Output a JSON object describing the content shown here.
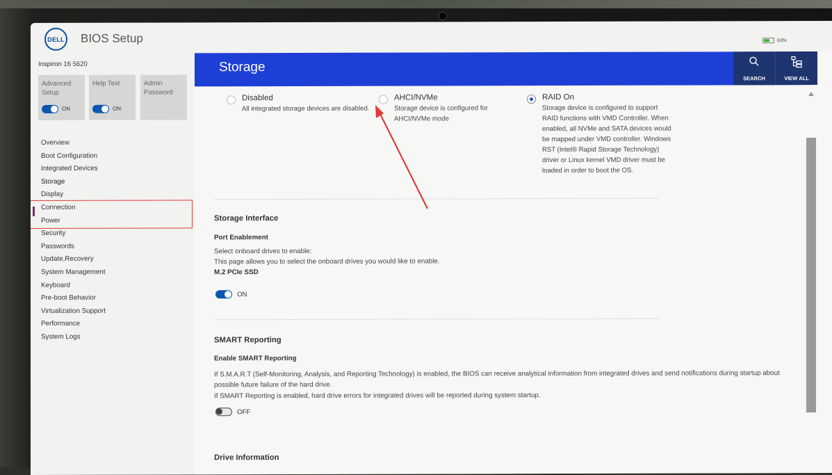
{
  "window": {
    "app_title": "BIOS Setup",
    "logo_text": "DELL",
    "battery_level": "63%"
  },
  "sidebar": {
    "model": "Inspiron 16 5620",
    "tiles": [
      {
        "label": "Advanced Setup",
        "toggle_state": "ON"
      },
      {
        "label": "Help Text",
        "toggle_state": "ON"
      },
      {
        "label": "Admin Password"
      }
    ],
    "items": [
      {
        "label": "Overview"
      },
      {
        "label": "Boot Configuration"
      },
      {
        "label": "Integrated Devices"
      },
      {
        "label": "Storage"
      },
      {
        "label": "Display"
      },
      {
        "label": "Connection"
      },
      {
        "label": "Power"
      },
      {
        "label": "Security"
      },
      {
        "label": "Passwords"
      },
      {
        "label": "Update,Recovery"
      },
      {
        "label": "System Management"
      },
      {
        "label": "Keyboard"
      },
      {
        "label": "Pre-boot Behavior"
      },
      {
        "label": "Virtualization Support"
      },
      {
        "label": "Performance"
      },
      {
        "label": "System Logs"
      }
    ],
    "active_item": "Storage"
  },
  "header": {
    "title": "Storage",
    "search_label": "SEARCH",
    "view_all_label": "VIEW ALL"
  },
  "sata_operation": {
    "options": [
      {
        "label": "Disabled",
        "description": "All integrated storage devices are disabled.",
        "selected": false
      },
      {
        "label": "AHCI/NVMe",
        "description": "Storage device is configured for AHCI/NVMe mode",
        "selected": false
      },
      {
        "label": "RAID On",
        "description": "Storage device is configured to support RAID functions with VMD Controller. When enabled, all NVMe and SATA devices would be mapped under VMD controller. Windows RST (Intel® Rapid Storage Technology) driver or Linux kernel VMD driver must be loaded in order to boot the OS.",
        "selected": true
      }
    ]
  },
  "storage_interface": {
    "title": "Storage Interface",
    "subtitle": "Port Enablement",
    "line1": "Select onboard drives to enable:",
    "line2": "This page allows you to select the onboard drives you would like to enable.",
    "drive_label": "M.2 PCIe SSD",
    "drive_state": "ON"
  },
  "smart_reporting": {
    "title": "SMART Reporting",
    "subtitle": "Enable SMART Reporting",
    "para1": "If S.M.A.R.T (Self-Monitoring, Analysis, and Reporting Technology) is enabled, the BIOS can receive analytical information from integrated drives and send notifications during startup about possible future failure of the hard drive.",
    "para2": "If SMART Reporting is enabled, hard drive errors for integrated drives will be reported during system startup.",
    "state": "OFF"
  },
  "drive_information": {
    "title": "Drive Information"
  },
  "colors": {
    "title_bar": "#1e3fd6",
    "header_buttons": "#1f3570",
    "toggle_on": "#0b57b0",
    "annotation": "#e23b3b"
  }
}
